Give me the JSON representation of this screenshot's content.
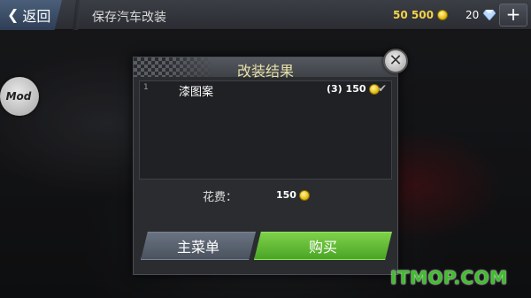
{
  "topbar": {
    "back_label": "返回",
    "title": "保存汽车改装",
    "coins": "50 500",
    "gems": "20",
    "plus_label": "+"
  },
  "mod_badge": {
    "label": "Mod"
  },
  "dialog": {
    "title": "改装结果",
    "close_icon": "close-icon",
    "items": [
      {
        "index": "1",
        "name": "漆图案",
        "price": "(3) 150",
        "checked": true
      }
    ],
    "cost_label": "花费：",
    "cost_value": "150",
    "main_menu_label": "主菜单",
    "buy_label": "购买"
  },
  "watermark": "ITMOP.COM",
  "colors": {
    "coin": "#e8c21c",
    "buy_green": "#5cb82f",
    "title_yellow": "#e7e0a8",
    "back_blue": "#3b4e68"
  }
}
